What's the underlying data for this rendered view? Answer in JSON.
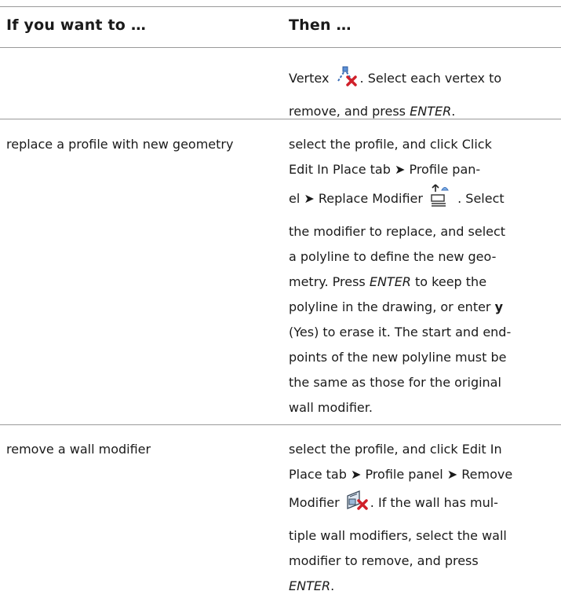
{
  "header": {
    "col1": "If you want to …",
    "col2": "Then …"
  },
  "row1": {
    "col1": "",
    "l1a": "Vertex",
    "l1b": ". Select each vertex to",
    "l2a": "remove, and press ",
    "l2b": "ENTER",
    "l2c": "."
  },
  "row2": {
    "col1": "replace a profile with new geometry",
    "l1": "select the profile, and click Click",
    "l2": "Edit In Place tab ➤ Profile pan-",
    "l3a": "el ➤ Replace Modifier",
    "l3b": ". Select",
    "l4": "the modifier to replace, and select",
    "l5": "a polyline to define the new geo-",
    "l6a": "metry. Press ",
    "l6b": "ENTER",
    "l6c": " to keep the",
    "l7a": "polyline in the drawing, or enter ",
    "l7b": "y",
    "l8": "(Yes) to erase it. The start and end-",
    "l9": "points of the new polyline must be",
    "l10": "the same as those for the original",
    "l11": "wall modifier."
  },
  "row3": {
    "col1": "remove a wall modifier",
    "l1": "select the profile, and click Edit In",
    "l2": "Place tab ➤ Profile panel ➤ Remove",
    "l3a": "Modifier",
    "l3b": ". If the wall has mul-",
    "l4": "tiple wall modifiers, select the wall",
    "l5": "modifier to remove, and press",
    "l6": "ENTER",
    "l6b": "."
  },
  "icons": {
    "vertex_remove": "remove-vertex-icon",
    "replace_modifier": "replace-modifier-icon",
    "remove_modifier": "remove-modifier-icon"
  },
  "colors": {
    "rule": "#9a9a9a",
    "icon_red": "#d0202a",
    "icon_blue": "#3d6fb8"
  }
}
